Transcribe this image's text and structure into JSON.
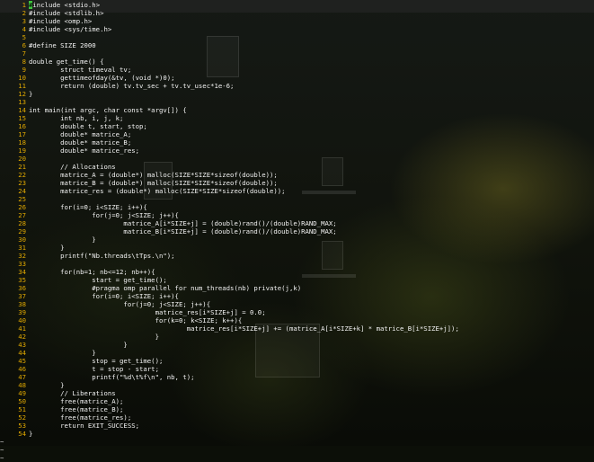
{
  "editor": {
    "lines": [
      {
        "n": "1",
        "code": "#include <stdio.h>"
      },
      {
        "n": "2",
        "code": "#include <stdlib.h>"
      },
      {
        "n": "3",
        "code": "#include <omp.h>"
      },
      {
        "n": "4",
        "code": "#include <sys/time.h>"
      },
      {
        "n": "5",
        "code": ""
      },
      {
        "n": "6",
        "code": "#define SIZE 2000"
      },
      {
        "n": "7",
        "code": ""
      },
      {
        "n": "8",
        "code": "double get_time() {"
      },
      {
        "n": "9",
        "code": "        struct timeval tv;"
      },
      {
        "n": "10",
        "code": "        gettimeofday(&tv, (void *)0);"
      },
      {
        "n": "11",
        "code": "        return (double) tv.tv_sec + tv.tv_usec*1e-6;"
      },
      {
        "n": "12",
        "code": "}"
      },
      {
        "n": "13",
        "code": ""
      },
      {
        "n": "14",
        "code": "int main(int argc, char const *argv[]) {"
      },
      {
        "n": "15",
        "code": "        int nb, i, j, k;"
      },
      {
        "n": "16",
        "code": "        double t, start, stop;"
      },
      {
        "n": "17",
        "code": "        double* matrice_A;"
      },
      {
        "n": "18",
        "code": "        double* matrice_B;"
      },
      {
        "n": "19",
        "code": "        double* matrice_res;"
      },
      {
        "n": "20",
        "code": ""
      },
      {
        "n": "21",
        "code": "        // Allocations"
      },
      {
        "n": "22",
        "code": "        matrice_A = (double*) malloc(SIZE*SIZE*sizeof(double));"
      },
      {
        "n": "23",
        "code": "        matrice_B = (double*) malloc(SIZE*SIZE*sizeof(double));"
      },
      {
        "n": "24",
        "code": "        matrice_res = (double*) malloc(SIZE*SIZE*sizeof(double));"
      },
      {
        "n": "25",
        "code": ""
      },
      {
        "n": "26",
        "code": "        for(i=0; i<SIZE; i++){"
      },
      {
        "n": "27",
        "code": "                for(j=0; j<SIZE; j++){"
      },
      {
        "n": "28",
        "code": "                        matrice_A[i*SIZE+j] = (double)rand()/(double)RAND_MAX;"
      },
      {
        "n": "29",
        "code": "                        matrice_B[i*SIZE+j] = (double)rand()/(double)RAND_MAX;"
      },
      {
        "n": "30",
        "code": "                }"
      },
      {
        "n": "31",
        "code": "        }"
      },
      {
        "n": "32",
        "code": "        printf(\"Nb.threads\\tTps.\\n\");"
      },
      {
        "n": "33",
        "code": ""
      },
      {
        "n": "34",
        "code": "        for(nb=1; nb<=12; nb++){"
      },
      {
        "n": "35",
        "code": "                start = get_time();"
      },
      {
        "n": "36",
        "code": "                #pragma omp parallel for num_threads(nb) private(j,k)"
      },
      {
        "n": "37",
        "code": "                for(i=0; i<SIZE; i++){"
      },
      {
        "n": "38",
        "code": "                        for(j=0; j<SIZE; j++){"
      },
      {
        "n": "39",
        "code": "                                matrice_res[i*SIZE+j] = 0.0;"
      },
      {
        "n": "40",
        "code": "                                for(k=0; k<SIZE; k++){"
      },
      {
        "n": "41",
        "code": "                                        matrice_res[i*SIZE+j] += (matrice_A[i*SIZE+k] * matrice_B[i*SIZE+j]);"
      },
      {
        "n": "42",
        "code": "                                }"
      },
      {
        "n": "43",
        "code": "                        }"
      },
      {
        "n": "44",
        "code": "                }"
      },
      {
        "n": "45",
        "code": "                stop = get_time();"
      },
      {
        "n": "46",
        "code": "                t = stop - start;"
      },
      {
        "n": "47",
        "code": "                printf(\"%d\\t%f\\n\", nb, t);"
      },
      {
        "n": "48",
        "code": "        }"
      },
      {
        "n": "49",
        "code": "        // Liberations"
      },
      {
        "n": "50",
        "code": "        free(matrice_A);"
      },
      {
        "n": "51",
        "code": "        free(matrice_B);"
      },
      {
        "n": "52",
        "code": "        free(matrice_res);"
      },
      {
        "n": "53",
        "code": "        return EXIT_SUCCESS;"
      },
      {
        "n": "54",
        "code": "}"
      }
    ],
    "tilde_lines": [
      "~",
      "~",
      "~"
    ],
    "cursor_char": "#",
    "colors": {
      "line_numbers": "#e0a800",
      "text": "#f2f2f2",
      "cursor": "#3ec43e",
      "tilde": "#c7c7c7"
    }
  }
}
